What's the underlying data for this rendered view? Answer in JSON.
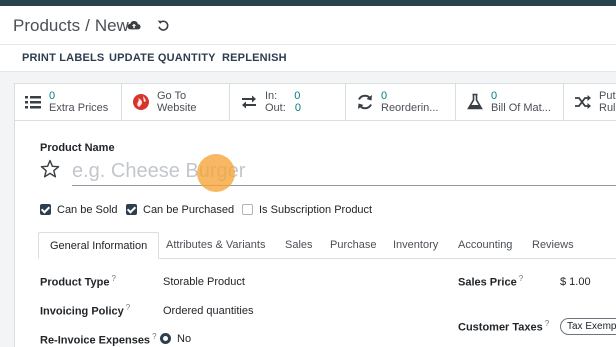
{
  "breadcrumb": {
    "parent": "Products",
    "separator": "/",
    "current": "New"
  },
  "header_icons": {
    "save": "cloud-upload-icon",
    "discard": "undo-icon"
  },
  "actions": {
    "print_labels": "PRINT LABELS",
    "update_quantity": "UPDATE QUANTITY",
    "replenish": "REPLENISH"
  },
  "smart_buttons": {
    "extra_prices": {
      "value": "0",
      "label": "Extra Prices",
      "icon": "list-icon"
    },
    "website": {
      "line1": "Go To",
      "line2": "Website",
      "icon": "globe-icon"
    },
    "in_out": {
      "in_label": "In:",
      "in_value": "0",
      "out_label": "Out:",
      "out_value": "0",
      "icon": "exchange-icon"
    },
    "reordering": {
      "value": "0",
      "label": "Reorderin...",
      "icon": "refresh-icon"
    },
    "bom": {
      "value": "0",
      "label": "Bill Of Mat...",
      "icon": "flask-icon"
    },
    "putaway": {
      "line1": "Putaw",
      "line2": "Rules",
      "icon": "shuffle-icon"
    }
  },
  "product": {
    "name_label": "Product Name",
    "name_placeholder": "e.g. Cheese Burger",
    "name_value": ""
  },
  "checkboxes": {
    "can_be_sold": {
      "label": "Can be Sold",
      "checked": true
    },
    "can_be_purchased": {
      "label": "Can be Purchased",
      "checked": true
    },
    "subscription": {
      "label": "Is Subscription Product",
      "checked": false
    }
  },
  "tabs": [
    {
      "label": "General Information",
      "active": true
    },
    {
      "label": "Attributes & Variants",
      "active": false
    },
    {
      "label": "Sales",
      "active": false
    },
    {
      "label": "Purchase",
      "active": false
    },
    {
      "label": "Inventory",
      "active": false
    },
    {
      "label": "Accounting",
      "active": false
    },
    {
      "label": "Reviews",
      "active": false
    }
  ],
  "fields": {
    "product_type": {
      "label": "Product Type",
      "help": "?",
      "value": "Storable Product"
    },
    "invoicing_policy": {
      "label": "Invoicing Policy",
      "help": "?",
      "value": "Ordered quantities"
    },
    "reinvoice": {
      "label": "Re-Invoice Expenses",
      "help": "?",
      "value": "No"
    },
    "sales_price": {
      "label": "Sales Price",
      "help": "?",
      "value": "$ 1.00"
    },
    "customer_taxes": {
      "label": "Customer Taxes",
      "help": "?",
      "value": "Tax Exempt"
    }
  },
  "colors": {
    "accent": "#017e84",
    "topbar": "#28434b",
    "checkbox": "#2c3e50"
  }
}
